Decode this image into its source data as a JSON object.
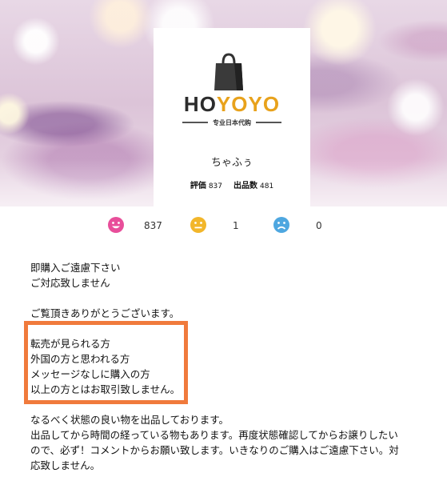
{
  "shop": {
    "logo": {
      "part1": "HO",
      "part2": "YOYO",
      "subtitle": "专业日本代购",
      "icon": "shopping-bag-icon"
    },
    "name": "ちゃふぅ",
    "rating_label": "評価",
    "rating_value": "837",
    "listings_label": "出品数",
    "listings_value": "481"
  },
  "ratings": {
    "good": {
      "icon": "smile-face-icon",
      "color": "#e84e9a",
      "count": "837"
    },
    "normal": {
      "icon": "neutral-face-icon",
      "color": "#f2b62a",
      "count": "1"
    },
    "bad": {
      "icon": "sad-face-icon",
      "color": "#4ea7e0",
      "count": "0"
    }
  },
  "description": {
    "block1": [
      "即購入ご遠慮下さい",
      "ご対応致しません"
    ],
    "block2": [
      "ご覧頂きありがとうございます。"
    ],
    "highlighted": [
      "転売が見られる方",
      "外国の方と思われる方",
      "メッセージなしに購入の方",
      "以上の方とはお取引致しません。"
    ],
    "block3": [
      "なるべく状態の良い物を出品しております。",
      "出品してから時間の経っている物もあります。再度状態確認してからお譲りしたい",
      "ので、必ず！コメントからお願い致します。いきなりのご購入はご遠慮下さい。対",
      "応致しません。"
    ]
  },
  "colors": {
    "highlight_border": "#f07a3c",
    "logo_accent": "#e8a21c"
  }
}
